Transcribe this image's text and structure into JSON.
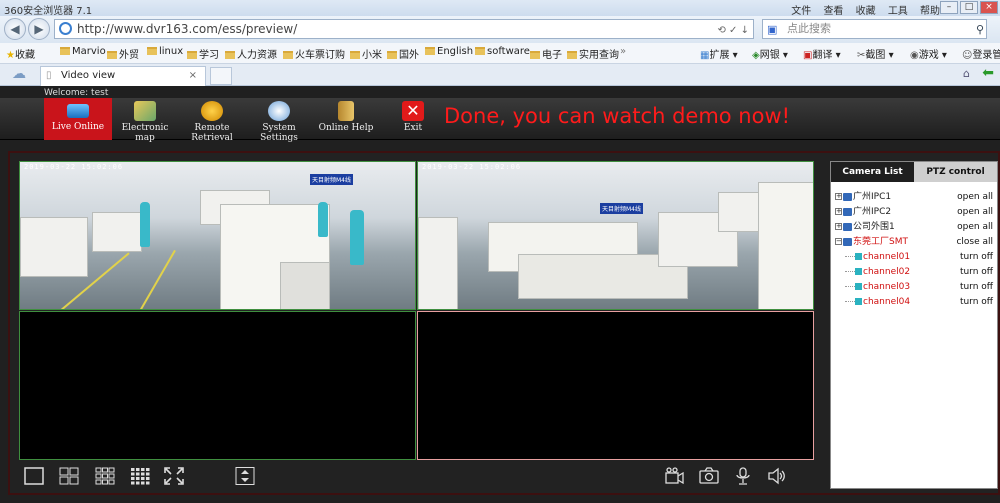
{
  "browser": {
    "title": "360安全浏览器 7.1",
    "menus": [
      "文件",
      "查看",
      "收藏",
      "工具",
      "帮助"
    ],
    "url": "http://www.dvr163.com/ess/preview/",
    "search_placeholder": "点此搜索",
    "favorites": [
      "收藏",
      "Marvio",
      "外贸",
      "linux",
      "学习",
      "人力资源",
      "火车票订购",
      "小米",
      "国外",
      "English",
      "software",
      "电子",
      "实用查询"
    ],
    "right_tools": [
      "扩展",
      "网银",
      "翻译",
      "截图",
      "游戏",
      "登录管"
    ],
    "tab_title": "Video view"
  },
  "app": {
    "welcome": "Welcome: test",
    "tools": [
      "Live Online",
      "Electronic map",
      "Remote Retrieval",
      "System Settings",
      "Online Help",
      "Exit"
    ],
    "banner": "Done, you can watch demo now!",
    "osd": [
      "2019-03-22 15:02:06",
      "2019-03-22 15:02:06"
    ],
    "side_tabs": [
      "Camera List",
      "PTZ control"
    ],
    "tree": [
      {
        "name": "广州IPC1",
        "action": "open all",
        "level": 0
      },
      {
        "name": "广州IPC2",
        "action": "open all",
        "level": 0
      },
      {
        "name": "公司外围1",
        "action": "open all",
        "level": 0
      },
      {
        "name": "东莞工厂SMT",
        "action": "close all",
        "level": 0,
        "highlight": true
      },
      {
        "name": "channel01",
        "action": "turn off",
        "level": 1
      },
      {
        "name": "channel02",
        "action": "turn off",
        "level": 1
      },
      {
        "name": "channel03",
        "action": "turn off",
        "level": 1
      },
      {
        "name": "channel04",
        "action": "turn off",
        "level": 1
      }
    ],
    "colors": {
      "accent": "#c9141b",
      "banner": "#ff1b1b",
      "selected_tree": "#d01010"
    }
  }
}
